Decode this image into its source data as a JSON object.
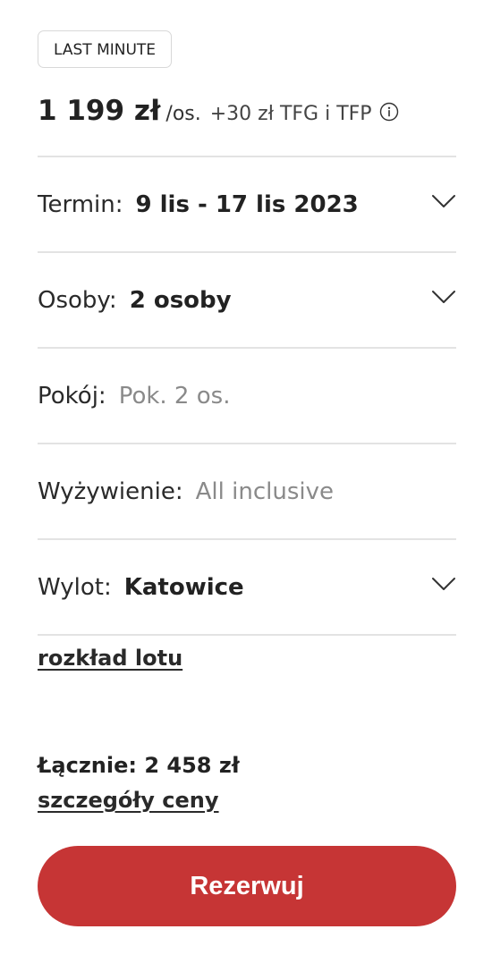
{
  "badge": "LAST MINUTE",
  "price": {
    "amount": "1 199 zł",
    "per_person": "/os.",
    "extra": "+30 zł TFG i TFP"
  },
  "fields": {
    "termin": {
      "label": "Termin:",
      "value": "9 lis - 17 lis 2023"
    },
    "osoby": {
      "label": "Osoby:",
      "value": "2 osoby"
    },
    "pokoj": {
      "label": "Pokój:",
      "value": "Pok. 2 os."
    },
    "wyzywienie": {
      "label": "Wyżywienie:",
      "value": "All inclusive"
    },
    "wylot": {
      "label": "Wylot:",
      "value": "Katowice"
    }
  },
  "flight_schedule_link": "rozkład lotu",
  "total": "Łącznie: 2 458 zł",
  "price_details_link": "szczegóły ceny",
  "book_button": "Rezerwuj",
  "colors": {
    "accent": "#c63535",
    "muted_text": "#8a8a8a",
    "divider": "#e3e3e3"
  },
  "icons": {
    "info": "info-icon",
    "dropdown": "chevron-down-icon"
  }
}
